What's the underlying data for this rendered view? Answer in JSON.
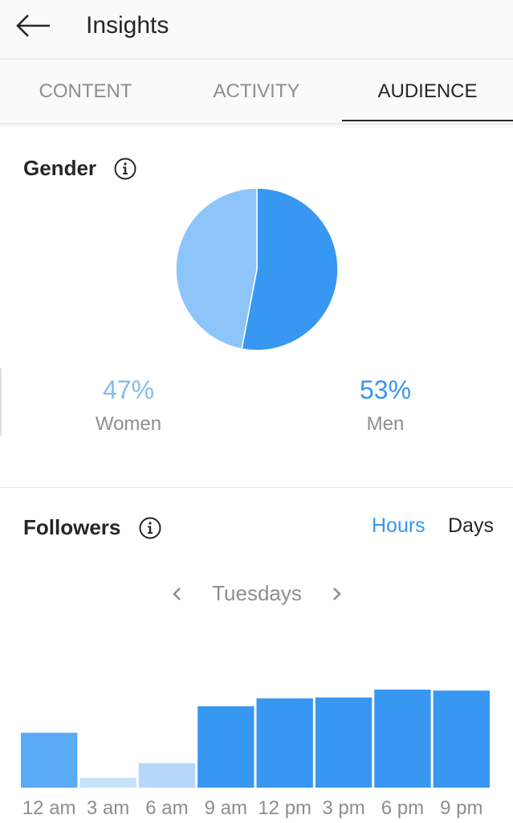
{
  "header": {
    "title": "Insights",
    "back_icon": "arrow-left-icon"
  },
  "tabs": [
    {
      "label": "CONTENT",
      "active": false
    },
    {
      "label": "ACTIVITY",
      "active": false
    },
    {
      "label": "AUDIENCE",
      "active": true
    }
  ],
  "gender": {
    "title": "Gender",
    "info_icon": "info-icon",
    "women": {
      "percent": "47%",
      "label": "Women"
    },
    "men": {
      "percent": "53%",
      "label": "Men"
    }
  },
  "followers": {
    "title": "Followers",
    "info_icon": "info-icon",
    "toggle": {
      "hours": "Hours",
      "days": "Days",
      "selected": "Hours"
    },
    "day": "Tuesdays"
  },
  "colors": {
    "women": "#8dc5fb",
    "men": "#3897f0",
    "accent_text": "#3897f0",
    "women_text": "#7fbdf3",
    "bar_dark": "#3897f0",
    "bar_mid": "#5aaaf5",
    "bar_light": "#c7e2fb",
    "bar_lighter": "#b5d8fa"
  },
  "chart_data": {
    "type": "bar",
    "categories": [
      "12 am",
      "3 am",
      "6 am",
      "9 am",
      "12 pm",
      "3 pm",
      "6 pm",
      "9 pm"
    ],
    "values": [
      56,
      10,
      25,
      83,
      91,
      92,
      100,
      99
    ],
    "ylim": [
      0,
      100
    ],
    "grid": false,
    "title": "",
    "xlabel": "",
    "ylabel": ""
  }
}
